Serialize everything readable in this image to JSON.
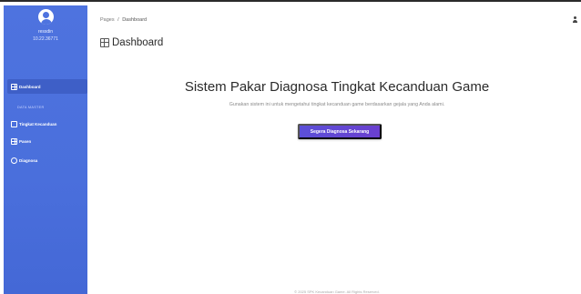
{
  "sidebar": {
    "user": {
      "name": "ressdin",
      "ip": "10.22.36771"
    },
    "items": [
      {
        "label": "Dashboard",
        "icon": "dashboard-icon"
      },
      {
        "label": "Tingkat Kecanduan",
        "icon": "document-icon"
      },
      {
        "label": "Pasen",
        "icon": "table-icon"
      },
      {
        "label": "Diagnosa",
        "icon": "diagnosis-icon"
      }
    ],
    "section_label": "DATA MASTER",
    "accent": "#4e73df"
  },
  "header": {
    "breadcrumb": {
      "root": "Pages",
      "separator": "/",
      "current": "Dashboard"
    },
    "title": "Dashboard"
  },
  "main": {
    "hero_title": "Sistem Pakar Diagnosa Tingkat Kecanduan Game",
    "hero_subtitle": "Gunakan sistem ini untuk mengetahui tingkat kecanduan game berdasarkan gejala yang Anda alami.",
    "cta_label": "Segera Diagnosa Sekarang",
    "cta_color": "#5b4fd8"
  },
  "footer": {
    "text": "© 2025 SPK Kecanduan Game. All Rights Reserved."
  }
}
